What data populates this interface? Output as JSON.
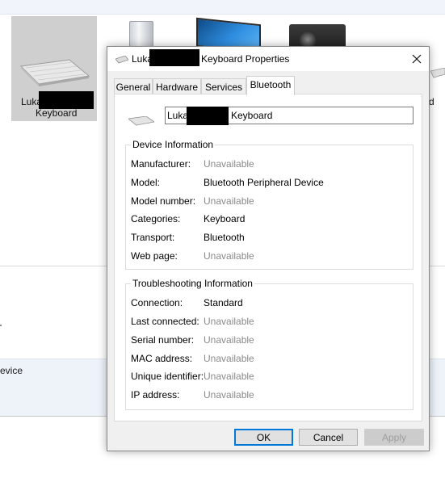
{
  "background": {
    "tile_label_prefix": "Luka",
    "tile_label_suffix": "Keyboard",
    "edge_label": "d",
    "details_text": "evice"
  },
  "dialog": {
    "title_prefix": "Luka",
    "title_suffix": "Keyboard Properties",
    "tabs": [
      {
        "label": "General"
      },
      {
        "label": "Hardware"
      },
      {
        "label": "Services"
      },
      {
        "label": "Bluetooth"
      }
    ],
    "active_tab": "Bluetooth",
    "name_field": {
      "prefix": "Luka",
      "suffix": "Keyboard"
    },
    "device_info": {
      "title": "Device Information",
      "rows": [
        {
          "label": "Manufacturer:",
          "value": "Unavailable",
          "muted": true
        },
        {
          "label": "Model:",
          "value": "Bluetooth Peripheral Device",
          "muted": false
        },
        {
          "label": "Model number:",
          "value": "Unavailable",
          "muted": true
        },
        {
          "label": "Categories:",
          "value": "Keyboard",
          "muted": false
        },
        {
          "label": "Transport:",
          "value": "Bluetooth",
          "muted": false
        },
        {
          "label": "Web page:",
          "value": "Unavailable",
          "muted": true
        }
      ]
    },
    "troubleshooting": {
      "title": "Troubleshooting Information",
      "rows": [
        {
          "label": "Connection:",
          "value": "Standard",
          "muted": false
        },
        {
          "label": "Last connected:",
          "value": "Unavailable",
          "muted": true
        },
        {
          "label": "Serial number:",
          "value": "Unavailable",
          "muted": true
        },
        {
          "label": "MAC address:",
          "value": "Unavailable",
          "muted": true
        },
        {
          "label": "Unique identifier:",
          "value": "Unavailable",
          "muted": true
        },
        {
          "label": "IP address:",
          "value": "Unavailable",
          "muted": true
        }
      ]
    },
    "buttons": {
      "ok": "OK",
      "cancel": "Cancel",
      "apply": "Apply"
    }
  },
  "colors": {
    "accent": "#0078d7",
    "muted_text": "#8a8a8a",
    "dialog_bg": "#f0f0f0"
  },
  "icons": [
    "keyboard-icon",
    "close-icon"
  ]
}
